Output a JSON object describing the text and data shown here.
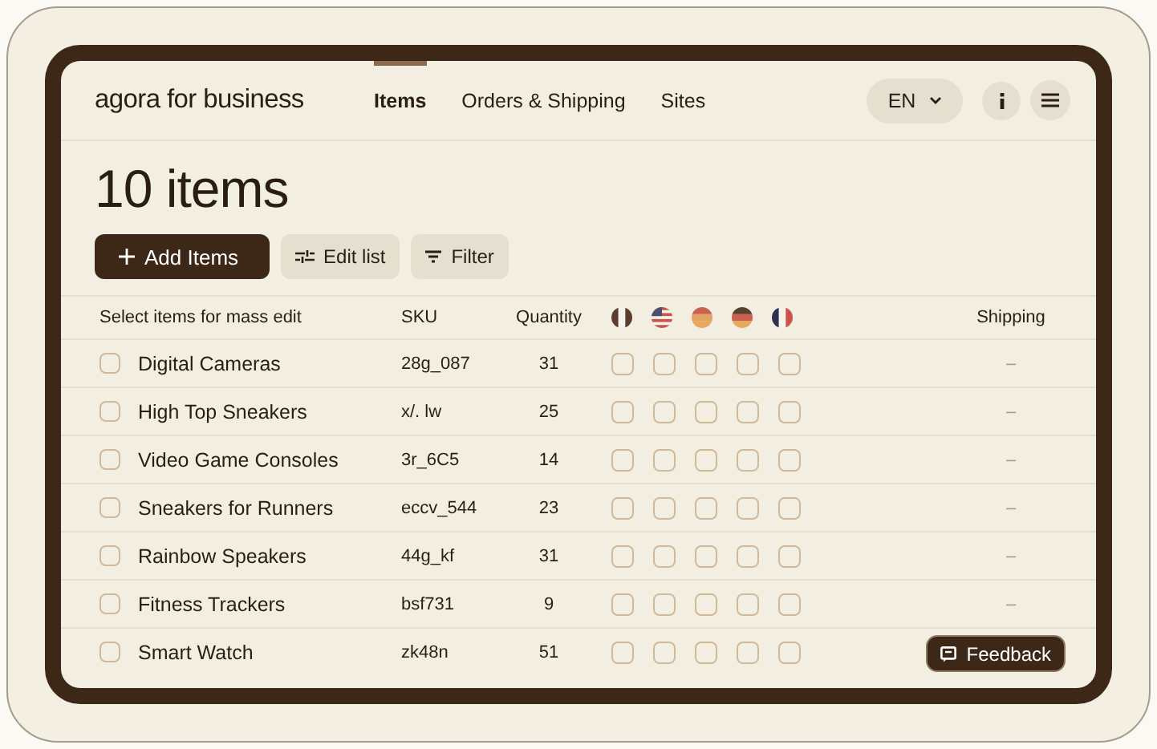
{
  "logo": "agora for business",
  "nav": [
    {
      "label": "Items",
      "selected": true
    },
    {
      "label": "Orders & Shipping",
      "selected": false
    },
    {
      "label": "Sites",
      "selected": false
    }
  ],
  "language": "EN",
  "title": "10 items",
  "actions": [
    {
      "label": "Add Items",
      "kind": "primary"
    },
    {
      "label": "Edit list",
      "kind": "edit"
    },
    {
      "label": "Filter",
      "kind": "filter"
    }
  ],
  "columns": {
    "select": "Select items for mass edit",
    "sku": "SKU",
    "quantity": "Quantity",
    "shipping": "Shipping"
  },
  "rows": [
    {
      "checked": false,
      "name": "Digital Cameras",
      "sku": "28g_087",
      "quantity": "31",
      "sites": [
        false,
        false,
        false,
        false,
        false
      ],
      "shipping": "–"
    },
    {
      "checked": false,
      "name": "High Top Sneakers",
      "sku": "x/. lw",
      "quantity": "25",
      "sites": [
        false,
        false,
        false,
        false,
        false
      ],
      "shipping": "–"
    },
    {
      "checked": false,
      "name": "Video Game Consoles",
      "sku": "3r_6C5",
      "quantity": "14",
      "sites": [
        false,
        false,
        false,
        false,
        false
      ],
      "shipping": "–"
    },
    {
      "checked": false,
      "name": "Sneakers for Runners",
      "sku": "eccv_544",
      "quantity": "23",
      "sites": [
        false,
        false,
        false,
        false,
        false
      ],
      "shipping": "–"
    },
    {
      "checked": false,
      "name": "Rainbow Speakers",
      "sku": "44g_kf",
      "quantity": "31",
      "sites": [
        false,
        false,
        false,
        false,
        false
      ],
      "shipping": "–"
    },
    {
      "checked": false,
      "name": "Fitness Trackers",
      "sku": "bsf731",
      "quantity": "9",
      "sites": [
        false,
        false,
        false,
        false,
        false
      ],
      "shipping": "–"
    },
    {
      "checked": false,
      "name": "Smart Watch",
      "sku": "zk48n",
      "quantity": "51",
      "sites": [
        false,
        false,
        false,
        false,
        false
      ]
    }
  ],
  "feedback": "Feedback"
}
